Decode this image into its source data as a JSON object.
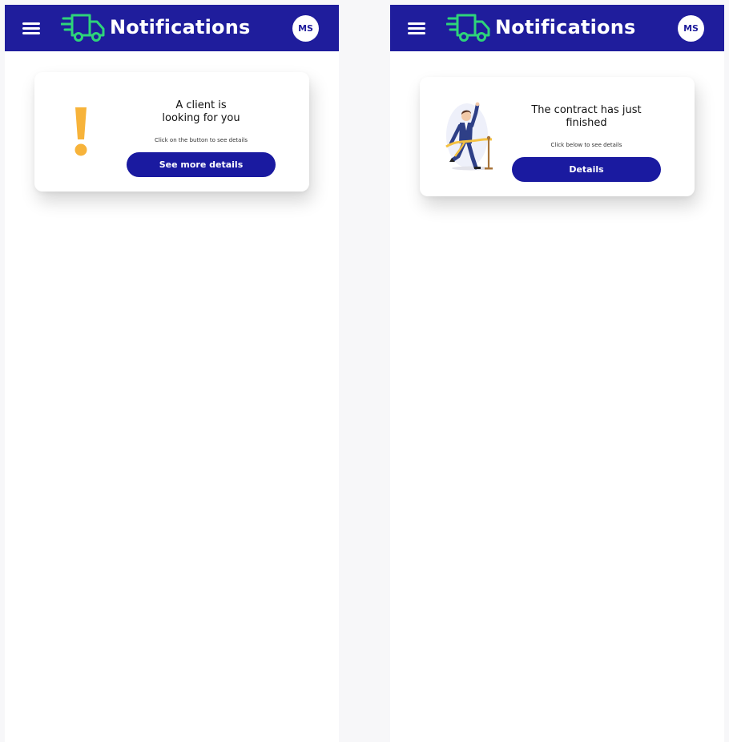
{
  "screens": [
    {
      "header": {
        "title": "Notifications",
        "avatar_initials": "MS",
        "menu_icon": "hamburger-menu-icon",
        "logo_icon": "delivery-truck-icon"
      },
      "card": {
        "icon": "exclamation-icon",
        "title_line1": "A client is",
        "title_line2": "looking for you",
        "caption": "Click on the button to see details",
        "button_label": "See more details"
      }
    },
    {
      "header": {
        "title": "Notifications",
        "avatar_initials": "MS",
        "menu_icon": "hamburger-menu-icon",
        "logo_icon": "delivery-truck-icon"
      },
      "card": {
        "icon": "finish-line-illustration",
        "title_line1": "The contract has just",
        "title_line2": "finished",
        "caption": "Click below to see details",
        "button_label": "Details"
      }
    }
  ],
  "colors": {
    "appbar": "#1f1d9c",
    "accent_green": "#2ed47a",
    "button": "#1a1aa0",
    "exclamation": "#f7b33a",
    "page_background": "#f7f7f9"
  }
}
